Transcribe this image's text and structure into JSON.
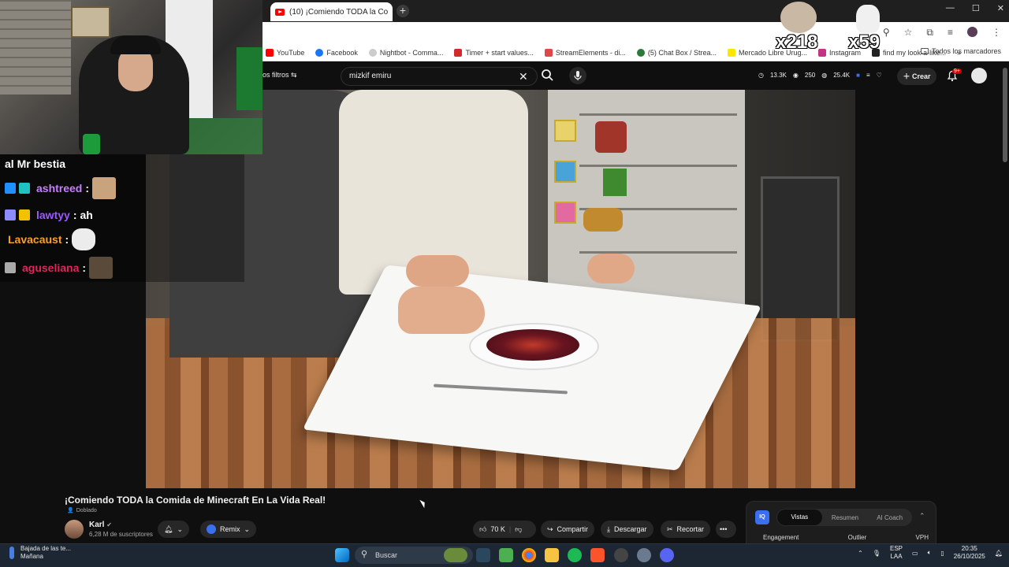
{
  "browser": {
    "tab_title": "(10) ¡Comiendo TODA la Co",
    "new_tab": "+",
    "window_controls": [
      "—",
      "☐",
      "✕"
    ],
    "bookmarks": [
      {
        "label": "YouTube",
        "color": "#ff0000"
      },
      {
        "label": "Facebook",
        "color": "#1877f2"
      },
      {
        "label": "Nightbot - Comma...",
        "color": "#cccccc"
      },
      {
        "label": "Timer + start values...",
        "color": "#d22b2b"
      },
      {
        "label": "StreamElements - di...",
        "color": "#e04848"
      },
      {
        "label": "(5) Chat Box / Strea...",
        "color": "#2a7a3a"
      },
      {
        "label": "Mercado Libre Urug...",
        "color": "#ffe600"
      },
      {
        "label": "Instagram",
        "color": "#c13584"
      },
      {
        "label": "find my look-a-like...",
        "color": "#222222"
      }
    ],
    "bookmarks_overflow": "»",
    "all_bookmarks": "Todos los marcadores"
  },
  "youtube_header": {
    "filters": "os filtros",
    "search_value": "mizkif emiru",
    "stats": [
      "13.3K",
      "250",
      "25.4K"
    ],
    "create_label": "Crear",
    "notifications_badge": "9+"
  },
  "overlay": {
    "counter_a": "x218",
    "counter_b": "x59"
  },
  "chat": {
    "messages": [
      {
        "user": "",
        "text": "al Mr bestia",
        "user_color": "#ffffff",
        "badges": [],
        "emote": false
      },
      {
        "user": "ashtreed",
        "text": "",
        "user_color": "#c77dff",
        "badges": [
          "#1e90ff",
          "#1fc2c2"
        ],
        "emote": true,
        "emote_color": "#c9a27e"
      },
      {
        "user": "lawtyy",
        "text": "ah",
        "user_color": "#9b59ff",
        "badges": [
          "#8c8cff",
          "#f2c200"
        ],
        "emote": false
      },
      {
        "user": "Lavacaust",
        "text": "",
        "user_color": "#ff9f1c",
        "badges": [],
        "emote": true,
        "emote_color": "#eeeeee"
      },
      {
        "user": "aguseliana",
        "text": "",
        "user_color": "#e0245e",
        "badges": [
          "#aaaaaa"
        ],
        "emote": true,
        "emote_color": "#5a4a3a"
      }
    ]
  },
  "video": {
    "title": "¡Comiendo TODA la Comida de Minecraft En La Vida Real!",
    "dubbed_label": "Doblado",
    "channel_name": "Karl",
    "subscribers": "6,28 M de suscriptores",
    "remix_label": "Remix",
    "likes": "70 K",
    "share_label": "Compartir",
    "download_label": "Descargar",
    "clip_label": "Recortar",
    "more_label": "•••"
  },
  "analytics_panel": {
    "logo": "IQ",
    "tabs": [
      "Vistas",
      "Resumen",
      "AI Coach"
    ],
    "active_tab": "Vistas",
    "columns": [
      "Engagement",
      "Outlier",
      "VPH"
    ]
  },
  "taskbar": {
    "weather_title": "Bajada de las te...",
    "weather_sub": "Mañana",
    "search_placeholder": "Buscar",
    "lang_top": "ESP",
    "lang_bottom": "LAA",
    "time": "20:35",
    "date": "26/10/2025"
  }
}
